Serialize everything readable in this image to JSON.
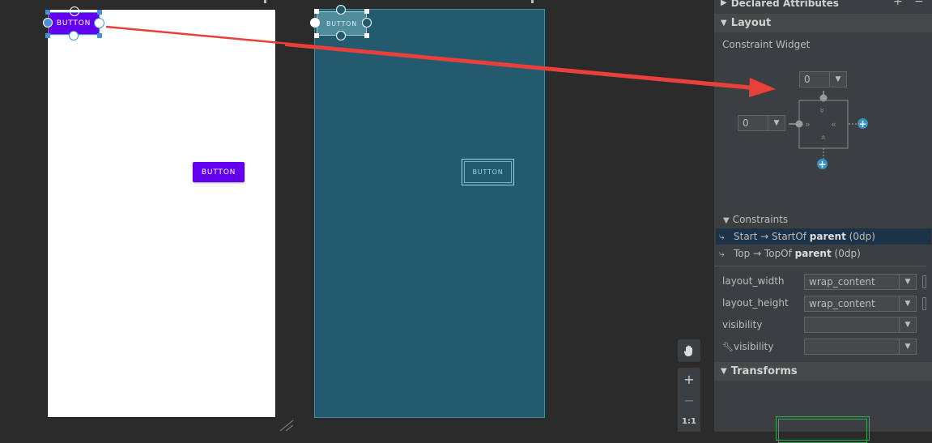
{
  "design": {
    "button_label": "BUTTON",
    "button2_label": "BUTTON"
  },
  "blueprint": {
    "button_label": "BUTTON",
    "button2_label": "BUTTON"
  },
  "zoom_toolbar": {
    "pan_icon": "hand-icon",
    "zoom_in": "+",
    "zoom_out": "−",
    "actual_size": "1:1"
  },
  "panel": {
    "declared_attributes": "Declared Attributes",
    "layout_header": "Layout",
    "constraint_widget_label": "Constraint Widget",
    "widget": {
      "top_margin": "0",
      "start_margin": "0"
    },
    "constraints_header": "Constraints",
    "constraints": [
      {
        "pre": "Start → StartOf ",
        "target": "parent",
        "post": " (0dp)"
      },
      {
        "pre": "Top → TopOf ",
        "target": "parent",
        "post": " (0dp)"
      }
    ],
    "attributes": [
      {
        "label": "layout_width",
        "value": "wrap_content"
      },
      {
        "label": "layout_height",
        "value": "wrap_content"
      },
      {
        "label": "visibility",
        "value": ""
      },
      {
        "label": "visibility",
        "value": ""
      }
    ],
    "transforms_header": "Transforms"
  },
  "colors": {
    "arrow": "#e8403a",
    "button": "#6200ee",
    "blueprint_bg": "#235a6e",
    "panel_bg": "#3c3f41",
    "accent_plus": "#3592c4"
  }
}
